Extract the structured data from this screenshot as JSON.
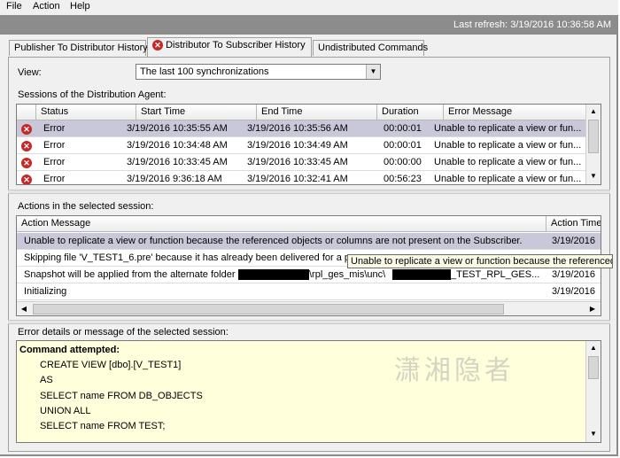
{
  "menu": {
    "file": "File",
    "action": "Action",
    "help": "Help"
  },
  "status": {
    "last_refresh": "Last refresh: 3/19/2016 10:36:58 AM"
  },
  "tabs": {
    "publisher": "Publisher To Distributor History",
    "distributor": "Distributor To Subscriber History",
    "undistributed": "Undistributed Commands"
  },
  "view": {
    "label": "View:",
    "selected": "The last 100 synchronizations"
  },
  "sessions": {
    "label": "Sessions of the Distribution Agent:",
    "columns": [
      "Status",
      "Start Time",
      "End Time",
      "Duration",
      "Error Message"
    ],
    "rows": [
      {
        "status": "Error",
        "start": "3/19/2016 10:35:55 AM",
        "end": "3/19/2016 10:35:56 AM",
        "duration": "00:00:01",
        "error": "Unable to replicate a view or fun..."
      },
      {
        "status": "Error",
        "start": "3/19/2016 10:34:48 AM",
        "end": "3/19/2016 10:34:49 AM",
        "duration": "00:00:01",
        "error": "Unable to replicate a view or fun..."
      },
      {
        "status": "Error",
        "start": "3/19/2016 10:33:45 AM",
        "end": "3/19/2016 10:33:45 AM",
        "duration": "00:00:00",
        "error": "Unable to replicate a view or fun..."
      },
      {
        "status": "Error",
        "start": "3/19/2016 9:36:18 AM",
        "end": "3/19/2016 10:32:41 AM",
        "duration": "00:56:23",
        "error": "Unable to replicate a view or fun..."
      }
    ]
  },
  "actions": {
    "label": "Actions in the selected session:",
    "columns": [
      "Action Message",
      "Action Time"
    ],
    "rows": [
      {
        "message": "Unable to replicate a view or function because the referenced objects or columns are not present on the Subscriber.",
        "time": "3/19/2016"
      },
      {
        "message": "Skipping file 'V_TEST1_6.pre' because it has already been delivered for a previ",
        "time": ""
      },
      {
        "message_a": "Snapshot will be applied from the alternate folder '\\\\",
        "message_b": "\\rpl_ges_mis\\unc\\",
        "message_c": "_TEST_RPL_GES...",
        "time": "3/19/2016"
      },
      {
        "message": "Initializing",
        "time": "3/19/2016"
      }
    ],
    "tooltip": "Unable to replicate a view or function because the referenced"
  },
  "details": {
    "label": "Error details or message of the selected session:",
    "heading": "Command attempted:",
    "lines": [
      "CREATE VIEW [dbo].[V_TEST1]",
      "AS",
      "SELECT name FROM DB_OBJECTS",
      "UNION ALL",
      "SELECT name FROM TEST;"
    ]
  },
  "watermark": "潇湘隐者",
  "icons": {
    "error": "error-circle-icon",
    "dropdown": "chevron-down-icon"
  },
  "colors": {
    "status_bar": "#8c8c8c",
    "selected_row": "#c8c8d8",
    "details_bg": "#ffffdc",
    "error_icon": "#c62828"
  }
}
